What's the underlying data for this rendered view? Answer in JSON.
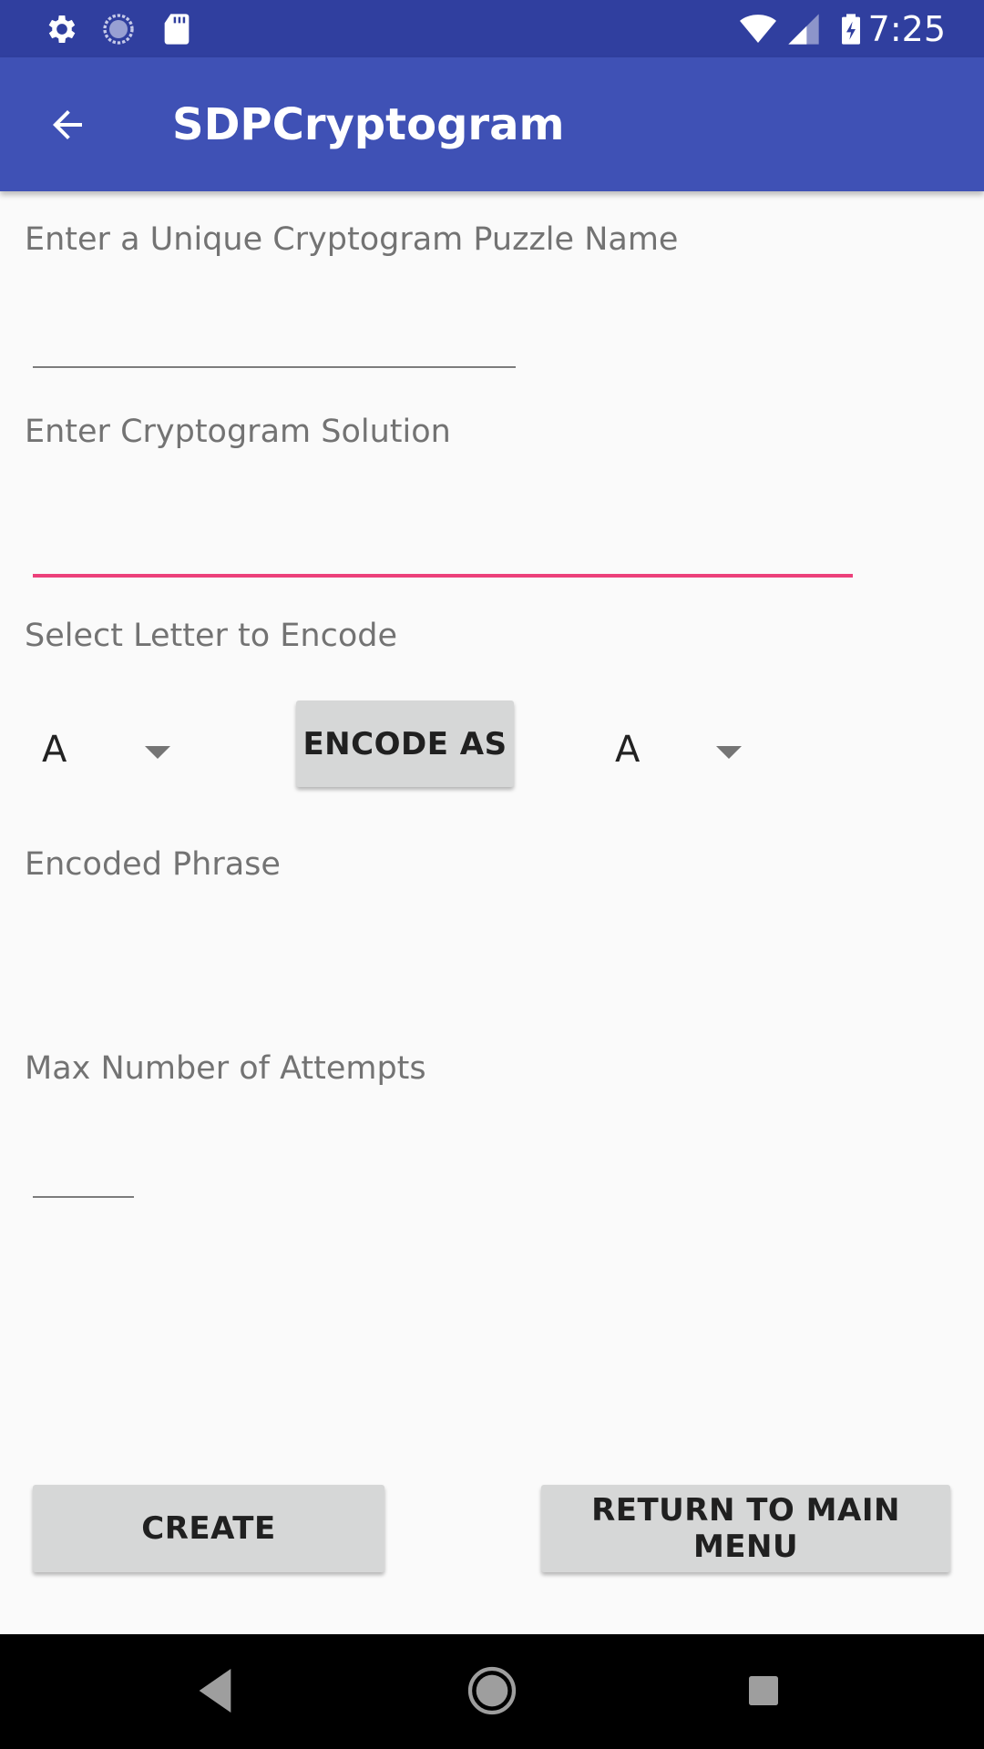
{
  "status_bar": {
    "time": "7:25",
    "icons": [
      "settings-icon",
      "sync-icon",
      "sd-card-icon",
      "wifi-icon",
      "signal-icon",
      "battery-charging-icon"
    ]
  },
  "app_bar": {
    "title": "SDPCryptogram",
    "back_icon": "arrow-back-icon"
  },
  "form": {
    "puzzle_name_label": "Enter a Unique Cryptogram Puzzle Name",
    "puzzle_name_value": "",
    "solution_label": "Enter Cryptogram Solution",
    "solution_value": "",
    "select_letter_label": "Select Letter to Encode",
    "source_letter": "A",
    "encode_button": "ENCODE AS",
    "target_letter": "A",
    "encoded_phrase_label": "Encoded Phrase",
    "encoded_phrase_value": "",
    "max_attempts_label": "Max Number of Attempts",
    "max_attempts_value": ""
  },
  "actions": {
    "create_button": "CREATE",
    "return_button": "RETURN TO MAIN MENU"
  },
  "colors": {
    "status_bar": "#303f9f",
    "app_bar": "#3f51b5",
    "accent": "#ec407a",
    "button": "#d6d7d7"
  },
  "nav_bar": {
    "icons": [
      "back-triangle-icon",
      "home-circle-icon",
      "recents-square-icon"
    ]
  }
}
